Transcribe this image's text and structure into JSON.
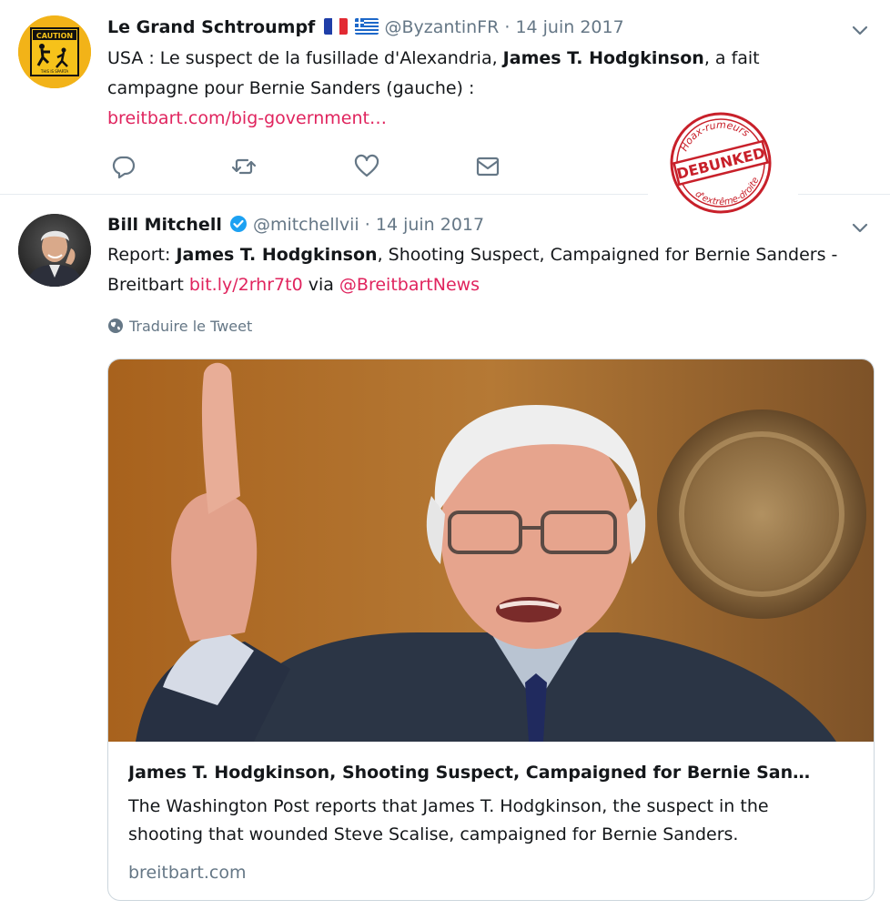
{
  "tweets": [
    {
      "name": "Le Grand Schtroumpf",
      "handle": "@ByzantinFR",
      "separator": "·",
      "date": "14 juin 2017",
      "text_parts": [
        "USA : Le suspect de la fusillade d'Alexandria, ",
        "James T. Hodgkinson",
        ", a fait campagne pour Bernie Sanders (gauche) :"
      ],
      "link": "breitbart.com/big-government…",
      "avatar": {
        "sign_text": "CAUTION",
        "sign_sub": "THIS IS SPARTA"
      },
      "icons": [
        "reply-icon",
        "retweet-icon",
        "like-icon",
        "message-icon"
      ]
    },
    {
      "name": "Bill Mitchell",
      "handle": "@mitchellvii",
      "separator": "·",
      "date": "14 juin 2017",
      "text_parts": [
        "Report: ",
        "James T. Hodgkinson",
        ", Shooting Suspect, Campaigned for Bernie Sanders - Breitbart "
      ],
      "link": "bit.ly/2rhr7t0",
      "via": " via ",
      "mention": "@BreitbartNews",
      "translate": "Traduire le Tweet",
      "card": {
        "title": "James T. Hodgkinson, Shooting Suspect, Campaigned for Bernie San…",
        "description": "The Washington Post reports that James T. Hodgkinson, the suspect in the shooting that wounded Steve Scalise, campaigned for Bernie Sanders.",
        "domain": "breitbart.com"
      }
    }
  ],
  "stamp": {
    "top_text": "Hoax-rumeurs",
    "main_text": "DEBUNKED",
    "bottom_text": "d'extrême-droite"
  },
  "colors": {
    "link": "#e0245e",
    "muted": "#657786",
    "verified": "#1da1f2",
    "stamp": "#c8202a"
  }
}
